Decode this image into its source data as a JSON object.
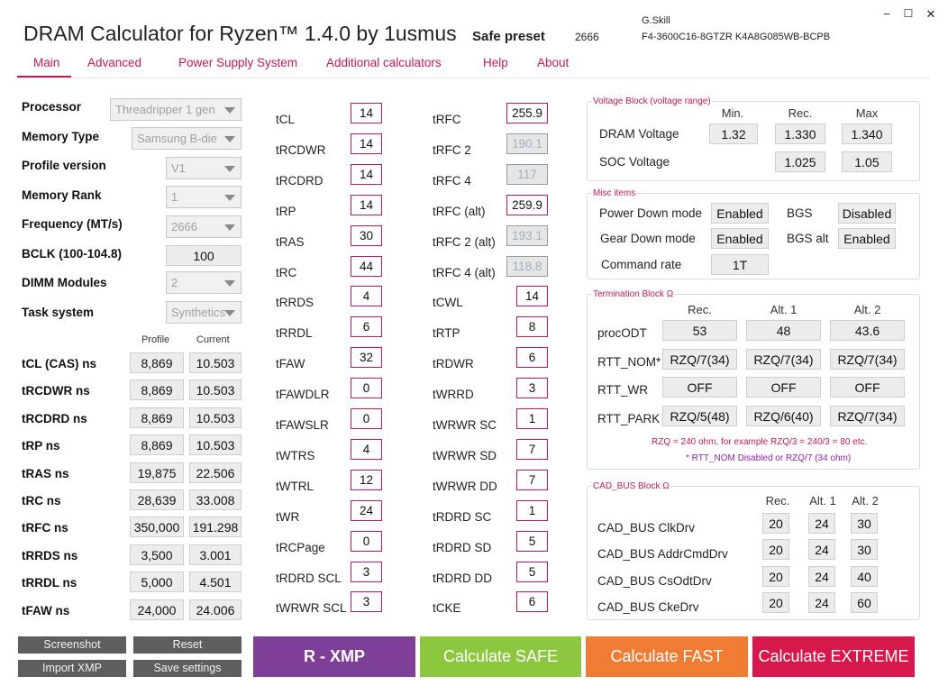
{
  "app": {
    "title": "DRAM Calculator for Ryzen™ 1.4.0 by 1usmus",
    "preset_label": "Safe preset",
    "preset_value": "2666",
    "vendor": "G.Skill",
    "part_number": "F4-3600C16-8GTZR K4A8G085WB-BCPB",
    "window_buttons": [
      "−",
      "☐",
      "✕"
    ]
  },
  "nav": [
    "Main",
    "Advanced",
    "Power Supply System",
    "Additional calculators",
    "Help",
    "About"
  ],
  "left": {
    "processor": {
      "label": "Processor",
      "value": "Threadripper 1 gen"
    },
    "memory_type": {
      "label": "Memory Type",
      "value": "Samsung B-die"
    },
    "profile_version": {
      "label": "Profile version",
      "value": "V1"
    },
    "memory_rank": {
      "label": "Memory Rank",
      "value": "1"
    },
    "frequency": {
      "label": "Frequency (MT/s)",
      "value": "2666"
    },
    "bclk": {
      "label": "BCLK (100-104.8)",
      "value": "100"
    },
    "dimm_modules": {
      "label": "DIMM Modules",
      "value": "2"
    },
    "task_system": {
      "label": "Task system",
      "value": "Synthetics"
    },
    "col_profile": "Profile",
    "col_current": "Current",
    "ns_rows": [
      {
        "label": "tCL (CAS) ns",
        "profile": "8,869",
        "current": "10.503"
      },
      {
        "label": "tRCDWR ns",
        "profile": "8,869",
        "current": "10.503"
      },
      {
        "label": "tRCDRD ns",
        "profile": "8,869",
        "current": "10.503"
      },
      {
        "label": "tRP ns",
        "profile": "8,869",
        "current": "10.503"
      },
      {
        "label": "tRAS ns",
        "profile": "19,875",
        "current": "22.506"
      },
      {
        "label": "tRC ns",
        "profile": "28,639",
        "current": "33.008"
      },
      {
        "label": "tRFC ns",
        "profile": "350,000",
        "current": "191.298"
      },
      {
        "label": "tRRDS ns",
        "profile": "3,500",
        "current": "3.001"
      },
      {
        "label": "tRRDL ns",
        "profile": "5,000",
        "current": "4.501"
      },
      {
        "label": "tFAW ns",
        "profile": "24,000",
        "current": "24.006"
      }
    ]
  },
  "timings_col1": [
    {
      "label": "tCL",
      "value": "14"
    },
    {
      "label": "tRCDWR",
      "value": "14"
    },
    {
      "label": "tRCDRD",
      "value": "14"
    },
    {
      "label": "tRP",
      "value": "14"
    },
    {
      "label": "tRAS",
      "value": "30"
    },
    {
      "label": "tRC",
      "value": "44"
    },
    {
      "label": "tRRDS",
      "value": "4"
    },
    {
      "label": "tRRDL",
      "value": "6"
    },
    {
      "label": "tFAW",
      "value": "32"
    },
    {
      "label": "tFAWDLR",
      "value": "0"
    },
    {
      "label": "tFAWSLR",
      "value": "0"
    },
    {
      "label": "tWTRS",
      "value": "4"
    },
    {
      "label": "tWTRL",
      "value": "12"
    },
    {
      "label": "tWR",
      "value": "24"
    },
    {
      "label": "tRCPage",
      "value": "0"
    },
    {
      "label": "tRDRD SCL",
      "value": "3"
    },
    {
      "label": "tWRWR SCL",
      "value": "3"
    }
  ],
  "timings_col2": [
    {
      "label": "tRFC",
      "value": "255.9"
    },
    {
      "label": "tRFC 2",
      "value": "190.1"
    },
    {
      "label": "tRFC 4",
      "value": "117"
    },
    {
      "label": "tRFC (alt)",
      "value": "259.9"
    },
    {
      "label": "tRFC 2 (alt)",
      "value": "193.1"
    },
    {
      "label": "tRFC 4 (alt)",
      "value": "118.8"
    },
    {
      "label": "tCWL",
      "value": "14"
    },
    {
      "label": "tRTP",
      "value": "8"
    },
    {
      "label": "tRDWR",
      "value": "6"
    },
    {
      "label": "tWRRD",
      "value": "3"
    },
    {
      "label": "tWRWR SC",
      "value": "1"
    },
    {
      "label": "tWRWR SD",
      "value": "7"
    },
    {
      "label": "tWRWR DD",
      "value": "7"
    },
    {
      "label": "tRDRD SC",
      "value": "1"
    },
    {
      "label": "tRDRD SD",
      "value": "5"
    },
    {
      "label": "tRDRD DD",
      "value": "5"
    },
    {
      "label": "tCKE",
      "value": "6"
    }
  ],
  "voltage": {
    "title": "Voltage Block (voltage range)",
    "headers": [
      "Min.",
      "Rec.",
      "Max"
    ],
    "dram": {
      "label": "DRAM Voltage",
      "min": "1.32",
      "rec": "1.330",
      "max": "1.340"
    },
    "soc": {
      "label": "SOC Voltage",
      "rec": "1.025",
      "max": "1.05"
    }
  },
  "misc": {
    "title": "Misc items",
    "power_down": {
      "label": "Power Down mode",
      "value": "Enabled"
    },
    "bgs": {
      "label": "BGS",
      "value": "Disabled"
    },
    "gear_down": {
      "label": "Gear Down mode",
      "value": "Enabled"
    },
    "bgs_alt": {
      "label": "BGS alt",
      "value": "Enabled"
    },
    "command_rate": {
      "label": "Command rate",
      "value": "1T"
    }
  },
  "termination": {
    "title": "Termination Block Ω",
    "headers": [
      "Rec.",
      "Alt. 1",
      "Alt. 2"
    ],
    "rows": [
      {
        "label": "procODT",
        "values": [
          "53",
          "48",
          "43.6"
        ]
      },
      {
        "label": "RTT_NOM*",
        "values": [
          "RZQ/7(34)",
          "RZQ/7(34)",
          "RZQ/7(34)"
        ]
      },
      {
        "label": "RTT_WR",
        "values": [
          "OFF",
          "OFF",
          "OFF"
        ]
      },
      {
        "label": "RTT_PARK",
        "values": [
          "RZQ/5(48)",
          "RZQ/6(40)",
          "RZQ/7(34)"
        ]
      }
    ],
    "note1": "RZQ = 240 ohm, for example RZQ/3 = 240/3 = 80 etc.",
    "note2": "* RTT_NOM Disabled or RZQ/7 (34 ohm)"
  },
  "cadbus": {
    "title": "CAD_BUS Block Ω",
    "headers": [
      "Rec.",
      "Alt. 1",
      "Alt. 2"
    ],
    "rows": [
      {
        "label": "CAD_BUS ClkDrv",
        "values": [
          "20",
          "24",
          "30"
        ]
      },
      {
        "label": "CAD_BUS AddrCmdDrv",
        "values": [
          "20",
          "24",
          "30"
        ]
      },
      {
        "label": "CAD_BUS CsOdtDrv",
        "values": [
          "20",
          "24",
          "40"
        ]
      },
      {
        "label": "CAD_BUS CkeDrv",
        "values": [
          "20",
          "24",
          "60"
        ]
      }
    ]
  },
  "buttons": {
    "screenshot": "Screenshot",
    "reset": "Reset",
    "import_xmp": "Import XMP",
    "save_settings": "Save settings",
    "rxmp": "R - XMP",
    "safe": "Calculate SAFE",
    "fast": "Calculate FAST",
    "extreme": "Calculate EXTREME"
  },
  "colors": {
    "accent": "#c2185b",
    "rxmp": "#7e3f98",
    "safe": "#8dc63f",
    "fast": "#f07c33",
    "extreme": "#d8174a"
  }
}
